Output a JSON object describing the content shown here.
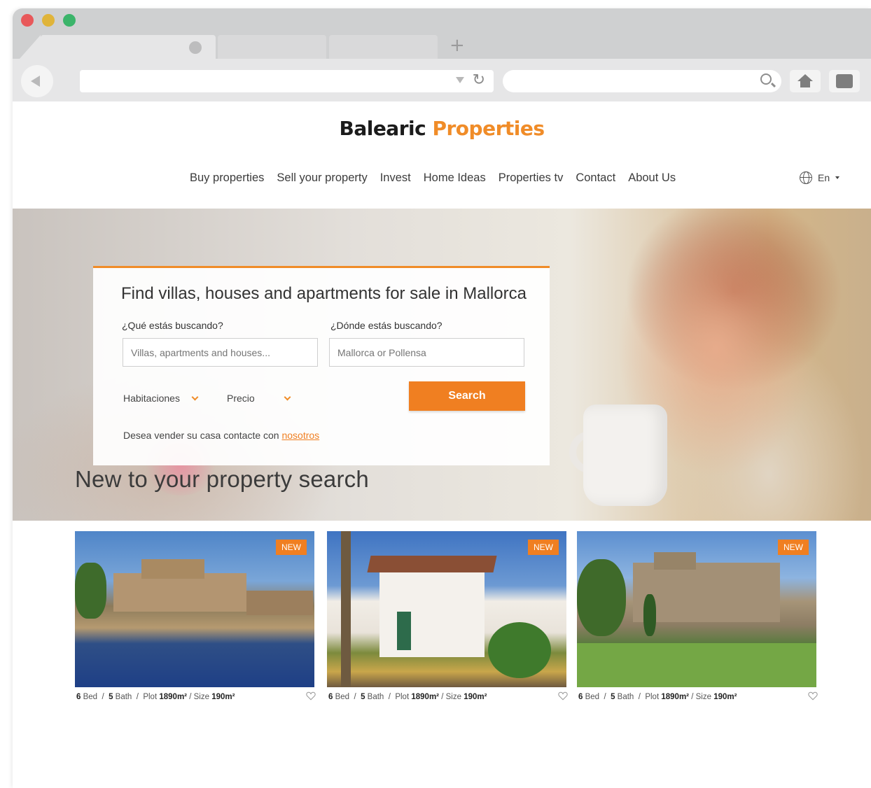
{
  "browser": {
    "tabs": [
      "",
      "",
      ""
    ],
    "new_tab_symbol": "+",
    "reload_symbol": "↻"
  },
  "site": {
    "logo_part1": "Balearic",
    "logo_part2": "Properties",
    "nav": [
      "Buy properties",
      "Sell your property",
      "Invest",
      "Home Ideas",
      "Properties tv",
      "Contact",
      "About Us"
    ],
    "language": "En"
  },
  "search": {
    "title": "Find villas, houses and apartments for sale in Mallorca",
    "what_label": "¿Qué estás buscando?",
    "what_placeholder": "Villas, apartments and houses...",
    "where_label": "¿Dónde estás buscando?",
    "where_placeholder": "Mallorca or Pollensa",
    "rooms_select": "Habitaciones",
    "price_select": "Precio",
    "button": "Search",
    "sell_text": "Desea vender su casa contacte con",
    "sell_link": "nosotros"
  },
  "listings": {
    "title": "New to your property search",
    "cards": [
      {
        "badge": "NEW",
        "bed": "6",
        "bath": "5",
        "plot": "1890m²",
        "size": "190m²"
      },
      {
        "badge": "NEW",
        "bed": "6",
        "bath": "5",
        "plot": "1890m²",
        "size": "190m²"
      },
      {
        "badge": "NEW",
        "bed": "6",
        "bath": "5",
        "plot": "1890m²",
        "size": "190m²"
      }
    ],
    "labels": {
      "bed": "Bed",
      "bath": "Bath",
      "plot": "Plot",
      "size": "Size",
      "sep": "/"
    }
  },
  "colors": {
    "accent": "#f07f21",
    "logo_dark": "#1b1b1b",
    "logo_orange": "#f08c28"
  }
}
